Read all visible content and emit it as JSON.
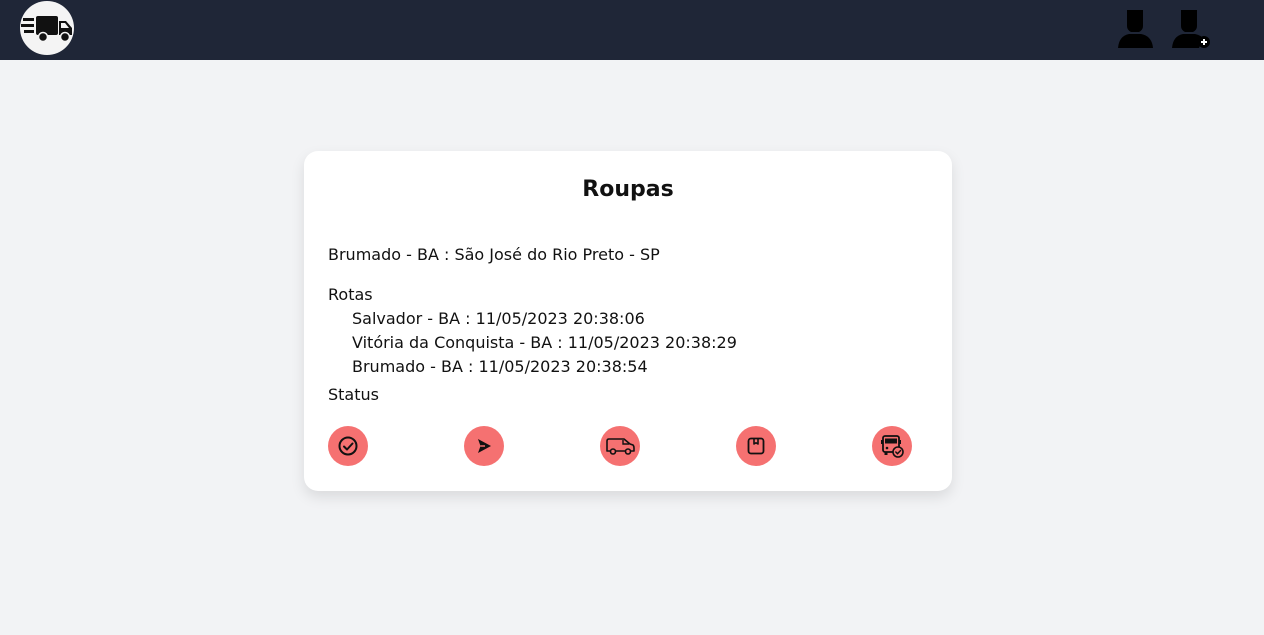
{
  "header": {
    "logo_icon": "delivery-truck-icon",
    "user_icon": "user-icon",
    "add_user_icon": "user-add-icon"
  },
  "card": {
    "title": "Roupas",
    "route": "Brumado - BA : São José do Rio Preto - SP",
    "rotas_label": "Rotas",
    "rotas": [
      "Salvador - BA : 11/05/2023 20:38:06",
      "Vitória da Conquista - BA : 11/05/2023 20:38:29",
      "Brumado - BA : 11/05/2023 20:38:54"
    ],
    "status_label": "Status",
    "status_icons": [
      "check-circle-icon",
      "send-icon",
      "van-icon",
      "package-icon",
      "truck-delivered-icon"
    ]
  },
  "colors": {
    "topbar": "#1f2637",
    "background": "#f2f3f5",
    "status_button": "#f57171"
  }
}
